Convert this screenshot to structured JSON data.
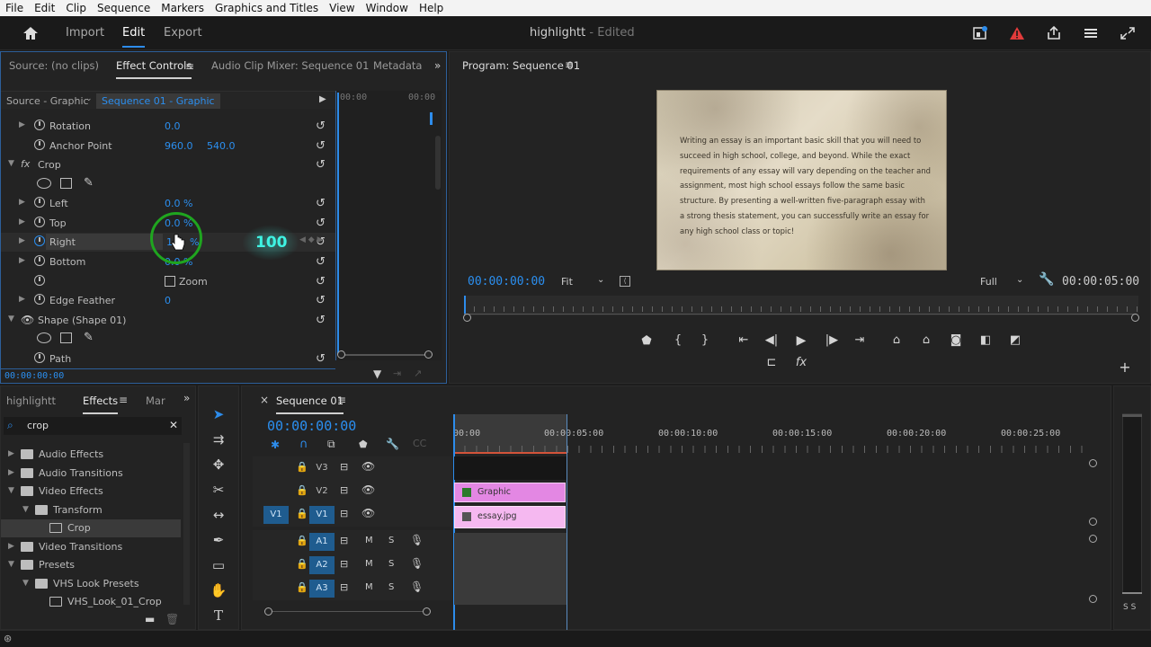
{
  "menu": [
    "File",
    "Edit",
    "Clip",
    "Sequence",
    "Markers",
    "Graphics and Titles",
    "View",
    "Window",
    "Help"
  ],
  "header": {
    "import": "Import",
    "edit": "Edit",
    "export": "Export",
    "project_title": "highlightt",
    "edited_suffix": "- Edited"
  },
  "source_panel": {
    "tabs": [
      "Source: (no clips)",
      "Effect Controls",
      "Audio Clip Mixer: Sequence 01",
      "Metadata"
    ],
    "source_label": "Source - Graphic",
    "sequence_label": "Sequence 01 - Graphic",
    "tl_time_a": "00:00",
    "tl_time_b": "00:00",
    "footer_time": "00:00:00:00",
    "rows": {
      "rotation": {
        "label": "Rotation",
        "value": "0.0"
      },
      "anchor": {
        "label": "Anchor Point",
        "value1": "960.0",
        "value2": "540.0"
      },
      "crop": {
        "label": "Crop"
      },
      "left": {
        "label": "Left",
        "value": "0.0 %"
      },
      "top": {
        "label": "Top",
        "value": "0.0 %"
      },
      "right": {
        "label": "Right",
        "value": "%"
      },
      "bottom": {
        "label": "Bottom",
        "value": "0.0 %"
      },
      "zoom": {
        "label": "Zoom"
      },
      "edge": {
        "label": "Edge Feather",
        "value": "0"
      },
      "shape": {
        "label": "Shape (Shape 01)"
      },
      "path": {
        "label": "Path"
      }
    },
    "overlay_value": "100"
  },
  "program": {
    "title": "Program: Sequence 01",
    "timecode": "00:00:00:00",
    "fit": "Fit",
    "full": "Full",
    "duration": "00:00:05:00",
    "essay_text": "Writing an essay is an important basic skill that you will need to succeed in high school, college, and beyond. While the exact requirements of any essay will vary depending on the teacher and assignment, most high school essays follow the same basic structure. By presenting a well-written five-paragraph essay with a strong thesis statement, you can successfully write an essay for any high school class or topic!"
  },
  "project": {
    "tabs": [
      "highlightt",
      "Effects",
      "Mar"
    ],
    "search_value": "crop",
    "tree": [
      {
        "label": "Audio Effects",
        "level": 0,
        "kind": "folder",
        "open": false
      },
      {
        "label": "Audio Transitions",
        "level": 0,
        "kind": "folder",
        "open": false
      },
      {
        "label": "Video Effects",
        "level": 0,
        "kind": "folder",
        "open": true
      },
      {
        "label": "Transform",
        "level": 1,
        "kind": "folder",
        "open": true
      },
      {
        "label": "Crop",
        "level": 2,
        "kind": "effect",
        "open": false
      },
      {
        "label": "Video Transitions",
        "level": 0,
        "kind": "folder",
        "open": false
      },
      {
        "label": "Presets",
        "level": 0,
        "kind": "folder",
        "open": true
      },
      {
        "label": "VHS Look Presets",
        "level": 1,
        "kind": "folder",
        "open": true
      },
      {
        "label": "VHS_Look_01_Crop",
        "level": 2,
        "kind": "effect",
        "open": false
      }
    ]
  },
  "timeline": {
    "tab": "Sequence 01",
    "timecode": "00:00:00:00",
    "ruler": [
      "00:00",
      "00:00:05:00",
      "00:00:10:00",
      "00:00:15:00",
      "00:00:20:00",
      "00:00:25:00"
    ],
    "tracks": [
      "V3",
      "V2",
      "V1",
      "A1",
      "A2",
      "A3"
    ],
    "v1_source": "V1",
    "clip_graphic": "Graphic",
    "clip_essay": "essay.jpg",
    "m": "M",
    "s": "S",
    "meter_label": "S S"
  },
  "colors": {
    "accent": "#2d8ceb",
    "clip_graphic": "#e387e3",
    "clip_essay": "#f5b8f0",
    "highlight_ring": "#1fa51f",
    "overlay_glow": "#3ff3e3"
  }
}
